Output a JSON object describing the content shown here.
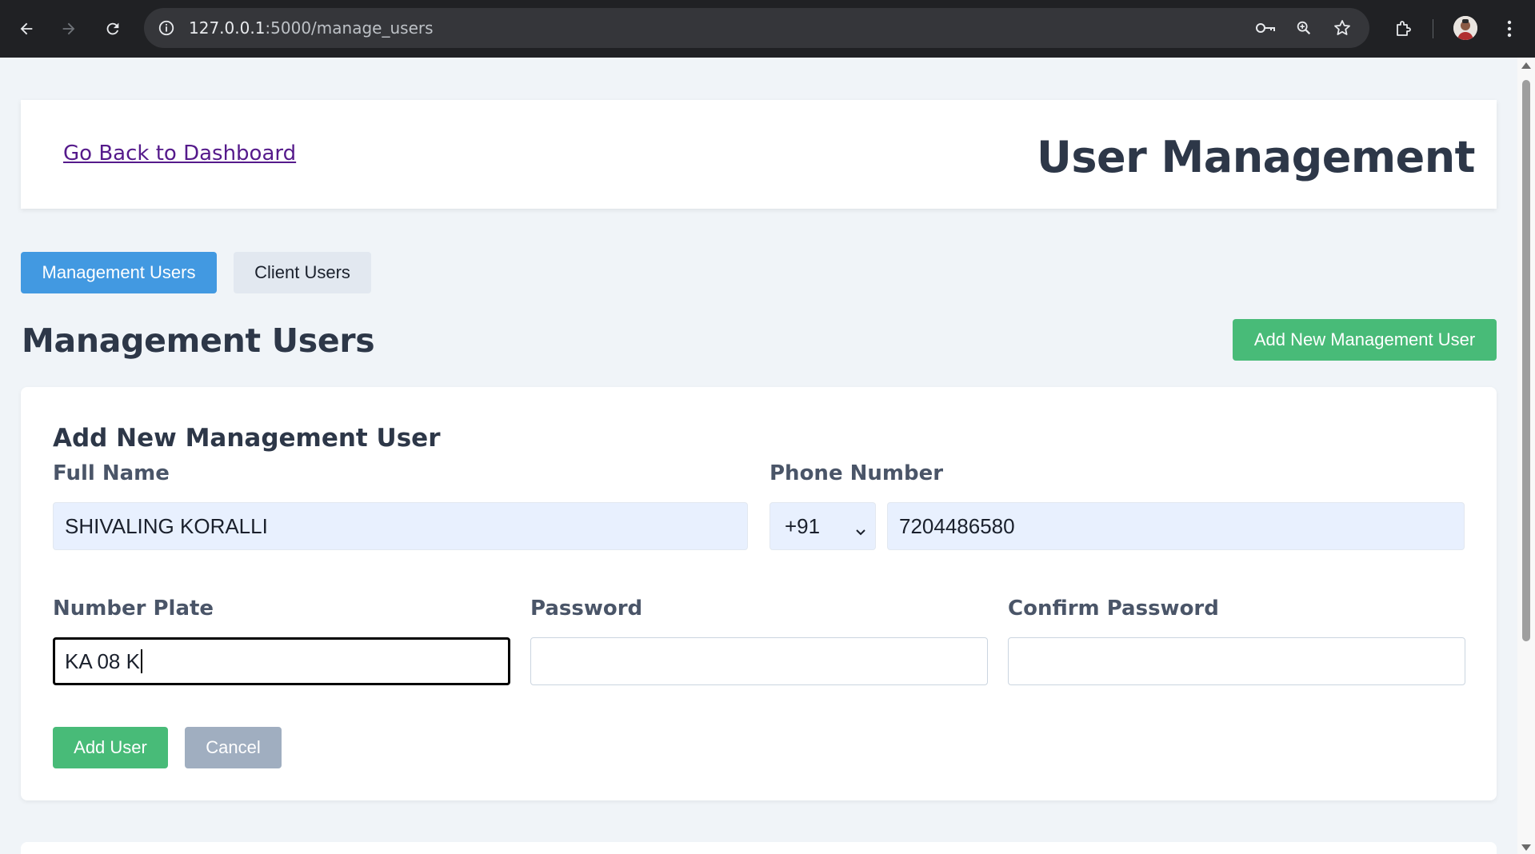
{
  "browser": {
    "url_host": "127.0.0.1",
    "url_path": ":5000/manage_users"
  },
  "header": {
    "back_link": "Go Back to Dashboard",
    "title": "User Management"
  },
  "tabs": [
    {
      "label": "Management Users",
      "active": true
    },
    {
      "label": "Client Users",
      "active": false
    }
  ],
  "section": {
    "title": "Management Users",
    "add_button": "Add New Management User"
  },
  "form": {
    "title": "Add New Management User",
    "full_name": {
      "label": "Full Name",
      "value": "SHIVALING KORALLI"
    },
    "phone": {
      "label": "Phone Number",
      "country_code": "+91",
      "value": "7204486580"
    },
    "number_plate": {
      "label": "Number Plate",
      "value": "KA 08 K"
    },
    "password": {
      "label": "Password",
      "value": ""
    },
    "confirm_password": {
      "label": "Confirm Password",
      "value": ""
    },
    "submit_label": "Add User",
    "cancel_label": "Cancel"
  },
  "colors": {
    "primary": "#4299e1",
    "success": "#48bb78",
    "muted": "#a0aec0",
    "heading": "#2d3748"
  }
}
